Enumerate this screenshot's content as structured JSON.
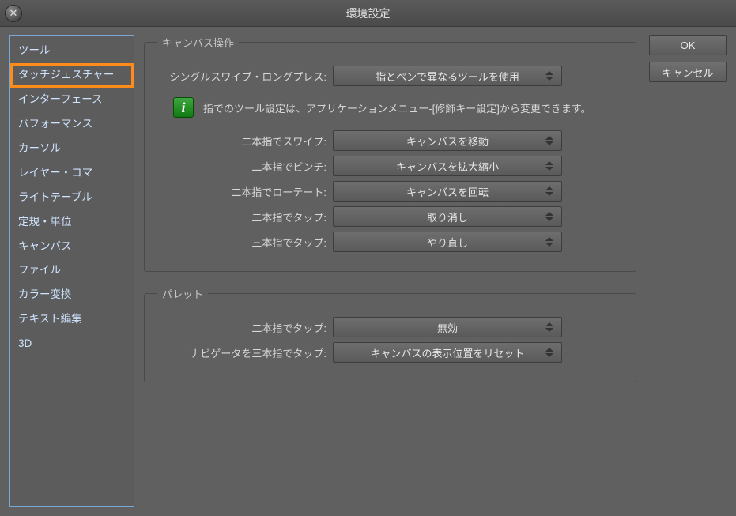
{
  "window": {
    "title": "環境設定"
  },
  "sidebar": {
    "items": [
      {
        "label": "ツール"
      },
      {
        "label": "タッチジェスチャー",
        "selected": true
      },
      {
        "label": "インターフェース"
      },
      {
        "label": "パフォーマンス"
      },
      {
        "label": "カーソル"
      },
      {
        "label": "レイヤー・コマ"
      },
      {
        "label": "ライトテーブル"
      },
      {
        "label": "定規・単位"
      },
      {
        "label": "キャンバス"
      },
      {
        "label": "ファイル"
      },
      {
        "label": "カラー変換"
      },
      {
        "label": "テキスト編集"
      },
      {
        "label": "3D"
      }
    ]
  },
  "buttons": {
    "ok": "OK",
    "cancel": "キャンセル"
  },
  "groups": {
    "canvas": {
      "legend": "キャンバス操作",
      "single_swipe_label": "シングルスワイプ・ロングプレス:",
      "single_swipe_value": "指とペンで異なるツールを使用",
      "info_text": "指でのツール設定は、アプリケーションメニュー-[修飾キー設定]から変更できます。",
      "two_swipe_label": "二本指でスワイプ:",
      "two_swipe_value": "キャンバスを移動",
      "two_pinch_label": "二本指でピンチ:",
      "two_pinch_value": "キャンバスを拡大縮小",
      "two_rotate_label": "二本指でローテート:",
      "two_rotate_value": "キャンバスを回転",
      "two_tap_label": "二本指でタップ:",
      "two_tap_value": "取り消し",
      "three_tap_label": "三本指でタップ:",
      "three_tap_value": "やり直し"
    },
    "palette": {
      "legend": "パレット",
      "two_tap_label": "二本指でタップ:",
      "two_tap_value": "無効",
      "nav_three_tap_label": "ナビゲータを三本指でタップ:",
      "nav_three_tap_value": "キャンバスの表示位置をリセット"
    }
  }
}
